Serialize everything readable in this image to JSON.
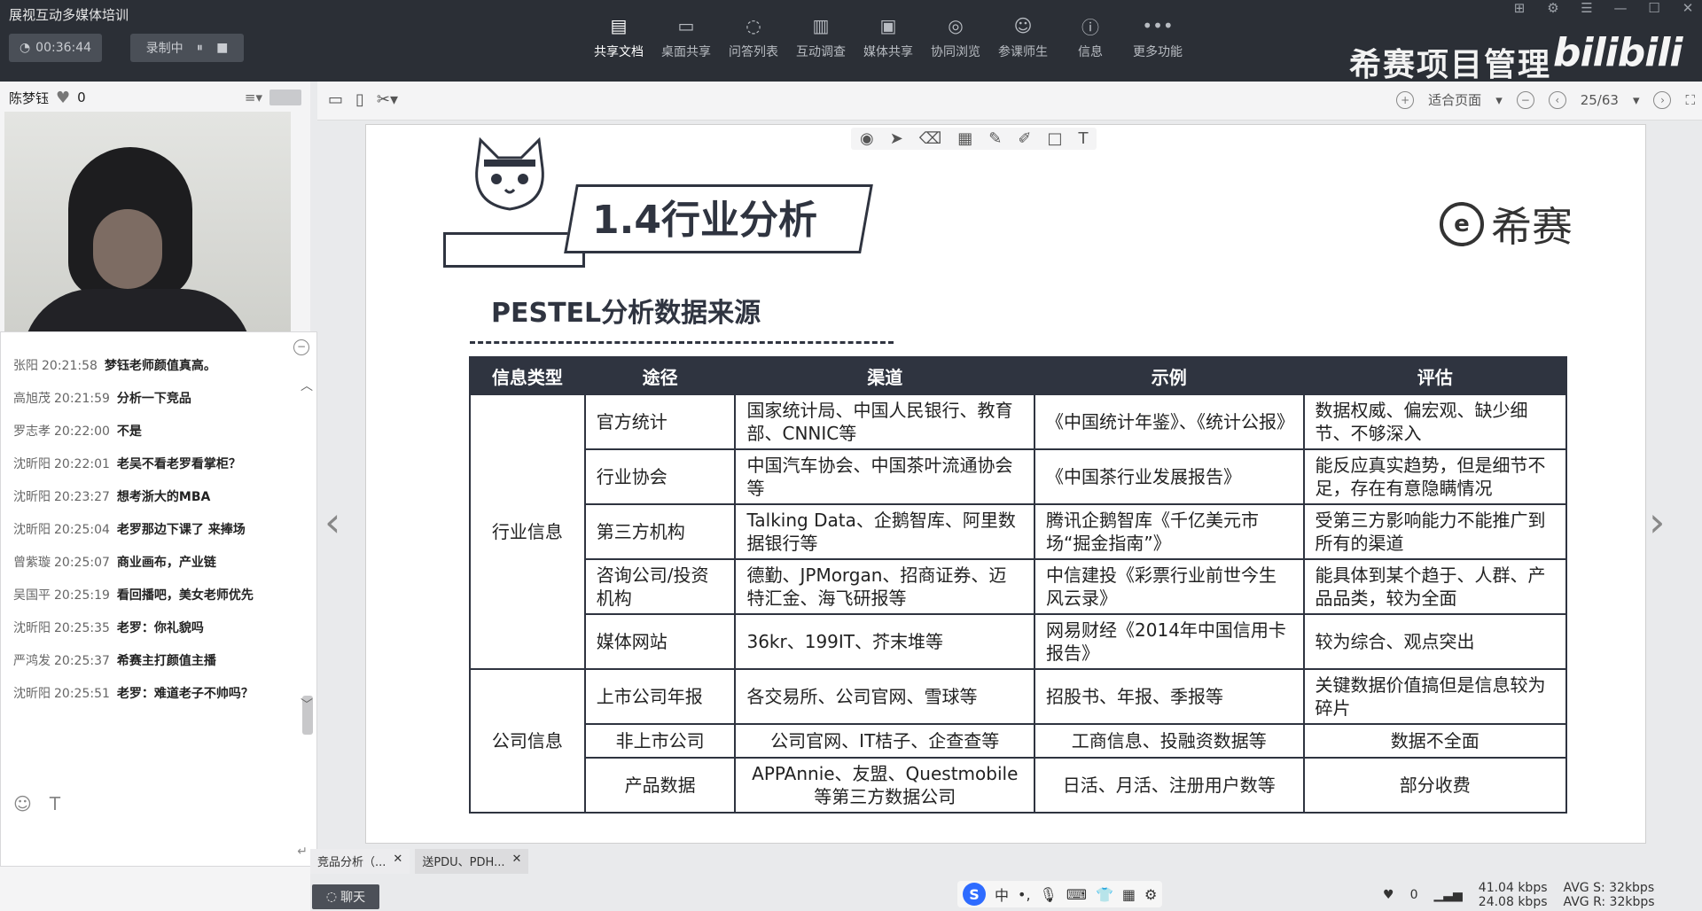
{
  "app": {
    "title": "展视互动多媒体培训",
    "timer": "00:36:44",
    "recording": "录制中"
  },
  "toolbar": [
    {
      "label": "共享文档",
      "icon": "document-icon"
    },
    {
      "label": "桌面共享",
      "icon": "desktop-share-icon"
    },
    {
      "label": "问答列表",
      "icon": "qa-icon"
    },
    {
      "label": "互动调查",
      "icon": "survey-icon"
    },
    {
      "label": "媒体共享",
      "icon": "media-icon"
    },
    {
      "label": "协同浏览",
      "icon": "compass-icon"
    },
    {
      "label": "参课师生",
      "icon": "people-icon"
    },
    {
      "label": "信息",
      "icon": "info-icon"
    },
    {
      "label": "更多功能",
      "icon": "more-icon"
    }
  ],
  "brand": "希赛项目管理",
  "bilibili": "bilibili",
  "presenter": {
    "name": "陈梦钰",
    "likes": "0"
  },
  "chat": {
    "messages": [
      {
        "name": "张阳",
        "time": "20:21:58",
        "text": "梦钰老师颜值真高。"
      },
      {
        "name": "高旭茂",
        "time": "20:21:59",
        "text": "分析一下竞品"
      },
      {
        "name": "罗志孝",
        "time": "20:22:00",
        "text": "不是"
      },
      {
        "name": "沈昕阳",
        "time": "20:22:01",
        "text": "老吴不看老罗看掌柜？"
      },
      {
        "name": "沈昕阳",
        "time": "20:23:27",
        "text": "想考浙大的MBA"
      },
      {
        "name": "沈昕阳",
        "time": "20:25:04",
        "text": "老罗那边下课了 来捧场"
      },
      {
        "name": "曾紫璇",
        "time": "20:25:07",
        "text": "商业画布，产业链"
      },
      {
        "name": "吴国平",
        "time": "20:25:19",
        "text": "看回播吧，美女老师优先"
      },
      {
        "name": "沈昕阳",
        "time": "20:25:35",
        "text": "老罗：你礼貌吗"
      },
      {
        "name": "严鸿发",
        "time": "20:25:37",
        "text": "希赛主打颜值主播"
      },
      {
        "name": "沈昕阳",
        "time": "20:25:51",
        "text": "老罗：难道老子不帅吗？"
      }
    ],
    "tab_label": "聊天"
  },
  "docbar": {
    "fit": "适合页面",
    "page": "25/63"
  },
  "slide": {
    "title": "1.4行业分析",
    "logo_text": "希赛",
    "subtitle": "PESTEL分析数据来源",
    "headers": [
      "信息类型",
      "途径",
      "渠道",
      "示例",
      "评估"
    ],
    "groups": [
      {
        "type": "行业信息",
        "rows": [
          [
            "官方统计",
            "国家统计局、中国人民银行、教育部、CNNIC等",
            "《中国统计年鉴》、《统计公报》",
            "数据权威、偏宏观、缺少细节、不够深入"
          ],
          [
            "行业协会",
            "中国汽车协会、中国茶叶流通协会等",
            "《中国茶行业发展报告》",
            "能反应真实趋势，但是细节不足，存在有意隐瞒情况"
          ],
          [
            "第三方机构",
            "Talking Data、企鹅智库、阿里数据银行等",
            "腾讯企鹅智库《千亿美元市场“掘金指南”》",
            "受第三方影响能力不能推广到所有的渠道"
          ],
          [
            "咨询公司/投资机构",
            "德勤、JPMorgan、招商证券、迈特汇金、海飞研报等",
            "中信建投《彩票行业前世今生风云录》",
            "能具体到某个趋于、人群、产品品类，较为全面"
          ],
          [
            "媒体网站",
            "36kr、199IT、芥末堆等",
            "网易财经《2014年中国信用卡报告》",
            "较为综合、观点突出"
          ]
        ]
      },
      {
        "type": "公司信息",
        "rows": [
          [
            "上市公司年报",
            "各交易所、公司官网、雪球等",
            "招股书、年报、季报等",
            "关键数据价值搞但是信息较为碎片"
          ],
          [
            "非上市公司",
            "公司官网、IT桔子、企查查等",
            "工商信息、投融资数据等",
            "数据不全面"
          ],
          [
            "产品数据",
            "APPAnnie、友盟、Questmobile等第三方数据公司",
            "日活、月活、注册用户数等",
            "部分收费"
          ]
        ]
      }
    ]
  },
  "doc_tabs": [
    "竞品分析（...",
    "送PDU、PDH..."
  ],
  "status": {
    "likes": "0",
    "up": "41.04 kbps",
    "down": "24.08 kbps",
    "avg_s": "AVG S: 32kbps",
    "avg_r": "AVG R: 32kbps",
    "ime_lang": "中"
  }
}
